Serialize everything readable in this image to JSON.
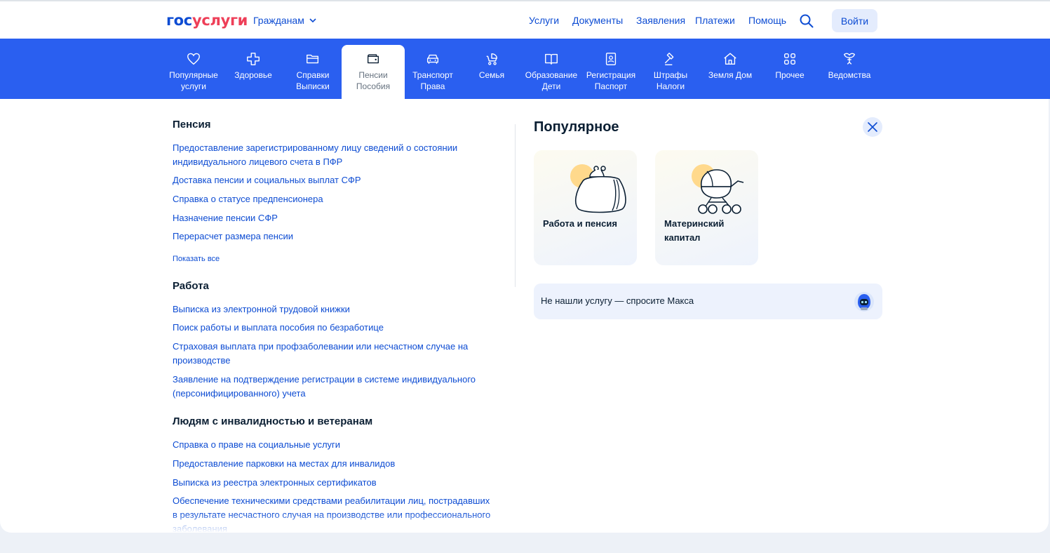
{
  "header": {
    "logo_part1": "гос",
    "logo_part2": "услуги",
    "audience_label": "Гражданам",
    "nav": [
      "Услуги",
      "Документы",
      "Заявления",
      "Платежи",
      "Помощь"
    ],
    "login_label": "Войти",
    "icons": {
      "search": "search-icon",
      "dropdown": "chevron-down-icon"
    }
  },
  "categories": [
    {
      "label": "Популярные\nуслуги",
      "icon": "heart-icon"
    },
    {
      "label": "Здоровье",
      "icon": "cross-icon"
    },
    {
      "label": "Справки\nВыписки",
      "icon": "folder-icon"
    },
    {
      "label": "Пенсии\nПособия",
      "icon": "wallet-icon",
      "active": true
    },
    {
      "label": "Транспорт\nПрава",
      "icon": "car-icon"
    },
    {
      "label": "Семья",
      "icon": "stroller-icon"
    },
    {
      "label": "Образование\nДети",
      "icon": "book-icon"
    },
    {
      "label": "Регистрация\nПаспорт",
      "icon": "id-card-icon"
    },
    {
      "label": "Штрафы\nНалоги",
      "icon": "gavel-icon"
    },
    {
      "label": "Земля Дом",
      "icon": "house-icon"
    },
    {
      "label": "Прочее",
      "icon": "grid-icon"
    },
    {
      "label": "Ведомства",
      "icon": "emblem-icon"
    }
  ],
  "sections": [
    {
      "title": "Пенсия",
      "links": [
        "Предоставление зарегистрированному лицу сведений о состоянии индивидуального лицевого счета в ПФР",
        "Доставка пенсии и социальных выплат СФР",
        "Справка о статусе предпенсионера",
        "Назначение пенсии СФР",
        "Перерасчет размера пенсии"
      ],
      "show_all": "Показать все"
    },
    {
      "title": "Работа",
      "links": [
        "Выписка из электронной трудовой книжки",
        "Поиск работы и выплата пособия по безработице",
        "Страховая выплата при профзаболевании или несчастном случае на производстве",
        "Заявление на подтверждение регистрации в системе индивидуального (персонифицированного) учета"
      ]
    },
    {
      "title": "Людям с инвалидностью и ветеранам",
      "links": [
        "Справка о праве на социальные услуги",
        "Предоставление парковки на местах для инвалидов",
        "Выписка из реестра электронных сертификатов",
        "Обеспечение техническими средствами реабилитации лиц, пострадавших в результате несчастного случая на производстве или профессионального заболевания"
      ]
    }
  ],
  "popular": {
    "title": "Популярное",
    "cards": [
      {
        "label": "Работа и пенсия",
        "icon": "purse-icon"
      },
      {
        "label": "Материнский\nкапитал",
        "icon": "baby-carriage-icon"
      }
    ],
    "ask": "Не нашли услугу — спросите Макса",
    "ask_icon": "robot-avatar-icon",
    "close_icon": "close-icon"
  },
  "colors": {
    "brand_blue": "#0d4cd3",
    "brand_red": "#ee3f58",
    "category_bar": "#2a5ff0",
    "text": "#0b1f33"
  }
}
